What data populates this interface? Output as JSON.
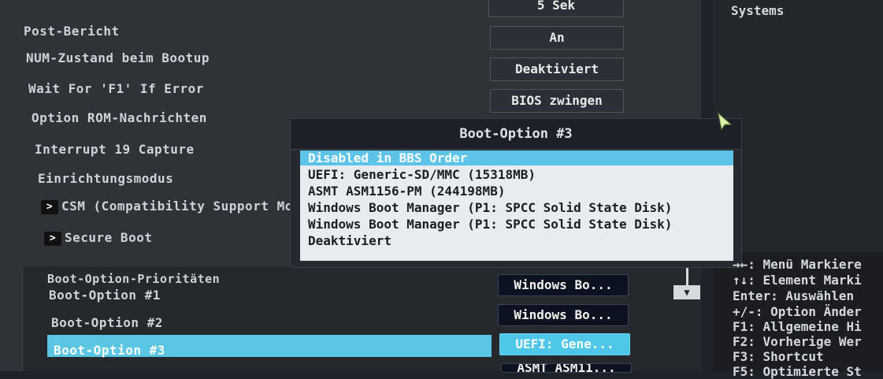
{
  "top_value": "5 Sek",
  "right_header": "Systems",
  "settings": [
    {
      "label": "Post-Bericht",
      "value": "An"
    },
    {
      "label": "NUM-Zustand beim Bootup",
      "value": "Deaktiviert"
    },
    {
      "label": "Wait For 'F1' If Error",
      "value": "BIOS zwingen"
    },
    {
      "label": "Option ROM-Nachrichten"
    },
    {
      "label": "Interrupt 19 Capture"
    },
    {
      "label": "Einrichtungsmodus"
    }
  ],
  "submenus": [
    "CSM (Compatibility Support Mo",
    "Secure Boot"
  ],
  "boot_section_title": "Boot-Option-Prioritäten",
  "boot_options": [
    {
      "label": "Boot-Option #1",
      "value": "Windows Bo..."
    },
    {
      "label": "Boot-Option #2",
      "value": "Windows Bo..."
    },
    {
      "label": "Boot-Option #3",
      "value": "UEFI: Gene..."
    }
  ],
  "boot_option4_value": "ASMT ASM11...",
  "popup": {
    "title": "Boot-Option #3",
    "items": [
      "Disabled in BBS Order",
      "UEFI: Generic-SD/MMC (15318MB)",
      "ASMT ASM1156-PM  (244198MB)",
      "Windows Boot Manager (P1: SPCC Solid State Disk)",
      "Windows Boot Manager (P1: SPCC Solid State Disk)",
      "Deaktiviert"
    ]
  },
  "help": [
    "→←: Menü Markiere",
    "↑↓: Element Marki",
    "Enter: Auswählen",
    "+/-: Option Änder",
    "F1: Allgemeine Hi",
    "F2: Vorherige Wer",
    "F3: Shortcut",
    "F5: Optimierte St"
  ],
  "colors": {
    "highlight": "#5ec3e8",
    "panel": "#2f3237"
  }
}
